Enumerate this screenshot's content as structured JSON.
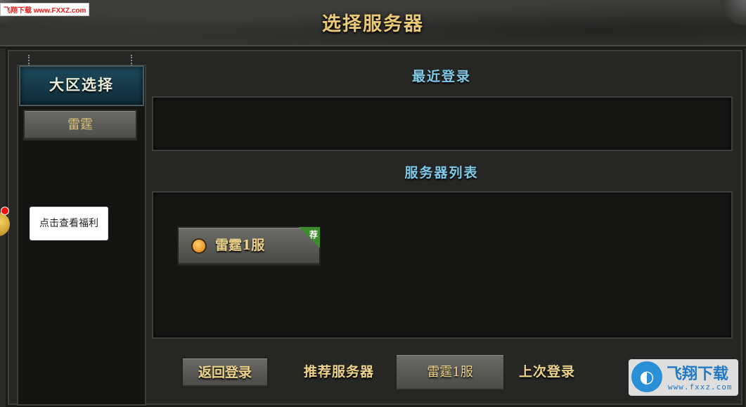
{
  "watermark_top": "飞翔下载 www.FXXZ.com",
  "title": "选择服务器",
  "zone": {
    "header": "大区选择",
    "selected_zone": "雷霆"
  },
  "welfare": {
    "tooltip": "点击查看福利"
  },
  "recent": {
    "title": "最近登录"
  },
  "server_list": {
    "title": "服务器列表",
    "servers": [
      {
        "name": "雷霆1服",
        "badge": "荐",
        "status_color": "#f08a14"
      }
    ]
  },
  "bottom": {
    "back_label": "返回登录",
    "recommend_label": "推荐服务器",
    "recommend_server": "雷霆1服",
    "last_login_label": "上次登录"
  },
  "watermark_logo": {
    "name": "飞翔下载",
    "url": "www.fxxz.com"
  },
  "colors": {
    "gold_text": "#ecd28a",
    "section_title": "#7fc9e9",
    "zone_header_bg": "#1d4a5c"
  }
}
